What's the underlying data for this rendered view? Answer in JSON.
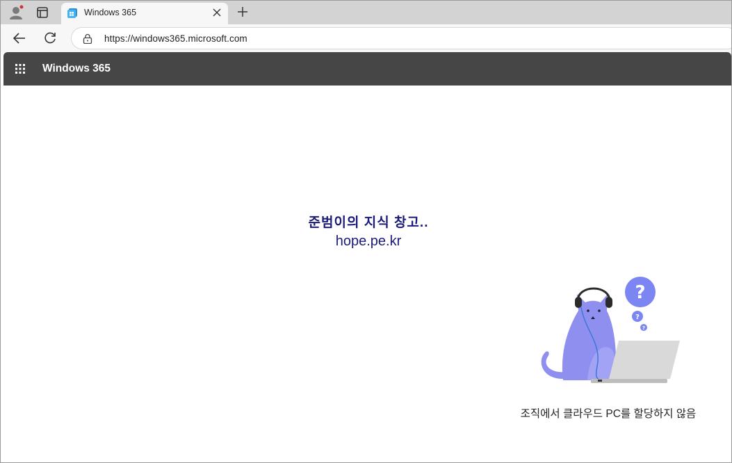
{
  "browser": {
    "tab": {
      "title": "Windows 365",
      "favicon": "windows365-icon"
    },
    "address": {
      "url": "https://windows365.microsoft.com"
    }
  },
  "app": {
    "title": "Windows 365"
  },
  "watermark": {
    "line1": "준범이의 지식 창고..",
    "line2": "hope.pe.kr"
  },
  "message": {
    "text": "조직에서 클라우드 PC를 할당하지 않음"
  },
  "colors": {
    "appbar": "#464646",
    "cat": "#8f8ff0",
    "question_bubble": "#7b86f2",
    "laptop": "#d9d9d9"
  }
}
